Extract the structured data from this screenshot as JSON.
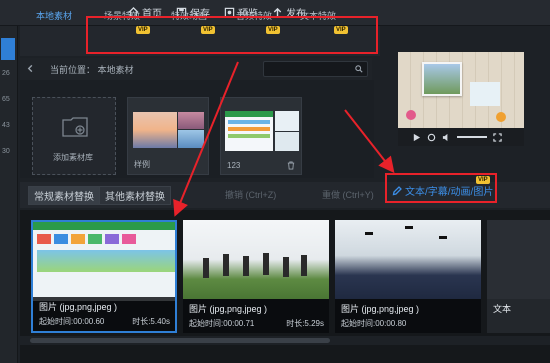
{
  "toolbar": {
    "home": "首页",
    "save": "保存",
    "preview": "预览",
    "publish": "发布"
  },
  "left_rail": {
    "nums": [
      "26",
      "65",
      "43",
      "30"
    ]
  },
  "resource_tabs": {
    "local": "本地素材",
    "scene": "场景特效",
    "anim": "特效动画",
    "audio": "音频特效",
    "text": "文本特效",
    "vip_badge": "VIP"
  },
  "path": {
    "label": "当前位置：",
    "value": "本地素材"
  },
  "materials": {
    "add": "添加素材库",
    "item1": "样例",
    "item2": "123"
  },
  "swap": {
    "tab1": "常规素材替换",
    "tab2": "其他素材替换",
    "undo": "撤销 (Ctrl+Z)",
    "redo": "重做 (Ctrl+Y)"
  },
  "text_button": "文本/字幕/动画/图片",
  "frames": [
    {
      "type": "图片 (jpg,png,jpeg )",
      "start": "起始时间:00:00.60",
      "dur": "时长:5.40s"
    },
    {
      "type": "图片 (jpg,png,jpeg )",
      "start": "起始时间:00:00.71",
      "dur": "时长:5.29s"
    },
    {
      "type": "图片 (jpg,png,jpeg )",
      "start": "起始时间:00:00.80",
      "dur": ""
    },
    {
      "type": "文本",
      "start": "",
      "dur": ""
    }
  ],
  "colors": {
    "accent": "#2f7fd6",
    "highlight_red": "#e8222a",
    "vip": "#f1c232"
  }
}
